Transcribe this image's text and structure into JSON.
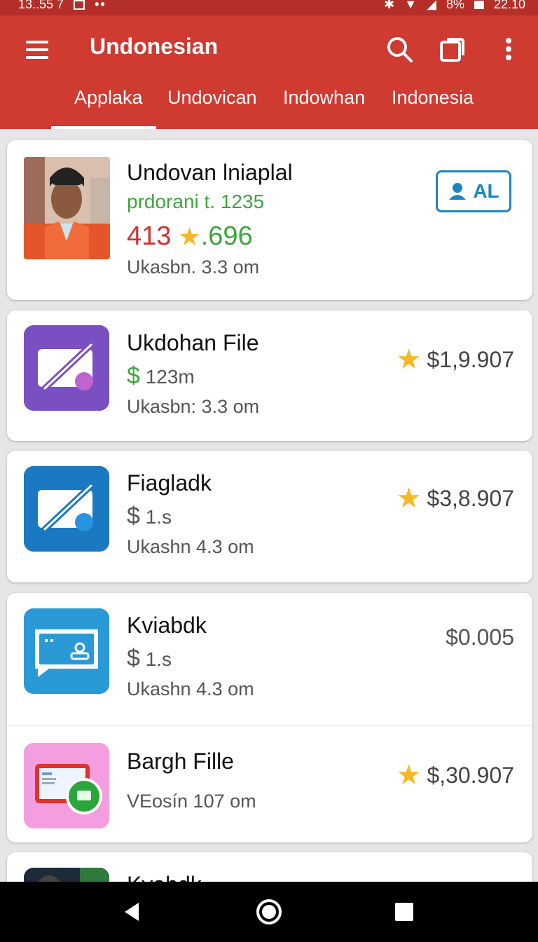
{
  "status_bar": {
    "time": "13..55 7",
    "battery": "8%",
    "clock": "22.10"
  },
  "app_bar": {
    "title": "Undonesian"
  },
  "tabs": [
    {
      "label": "Applaka"
    },
    {
      "label": "Undovican"
    },
    {
      "label": "Indowhan"
    },
    {
      "label": "Indonesia"
    }
  ],
  "active_tab": "Applaka",
  "items": [
    {
      "title": "Undovan lniaplal",
      "subtitle": "prdorani t. 1235",
      "rating_red": "413",
      "rating_green": ".696",
      "meta": "Ukasbn. 3.3 om",
      "action_label": "AL",
      "icon": "person-photo"
    },
    {
      "title": "Ukdohan File",
      "currency": "$",
      "price_line": "123m",
      "meta": "Ukasbn: 3.3 om",
      "value": "$1,9.907",
      "icon": "purple-pencil-app-icon"
    },
    {
      "title": "Fiagladk",
      "currency": "$",
      "price_line": "1.s",
      "meta": "Ukashn  4.3 om",
      "value": "$3,8.907",
      "icon": "blue-pencil-app-icon"
    },
    {
      "title": "Kviabdk",
      "currency": "$",
      "price_line": "1.s",
      "meta": "Ukashn  4.3 om",
      "value": "$0.005",
      "icon": "chat-app-icon"
    },
    {
      "title": "Bargh Fille",
      "meta": "VEosín 107 om",
      "value": "$,30.907",
      "icon": "pink-message-app-icon"
    },
    {
      "title": "Kvabdk",
      "icon": "person-photo"
    }
  ],
  "colors": {
    "app_bar": "#cf3a31",
    "status_bar": "#b52e27",
    "green": "#3ca63c",
    "red": "#cc3333",
    "star": "#f7b825",
    "accent_blue": "#1b86c6"
  }
}
